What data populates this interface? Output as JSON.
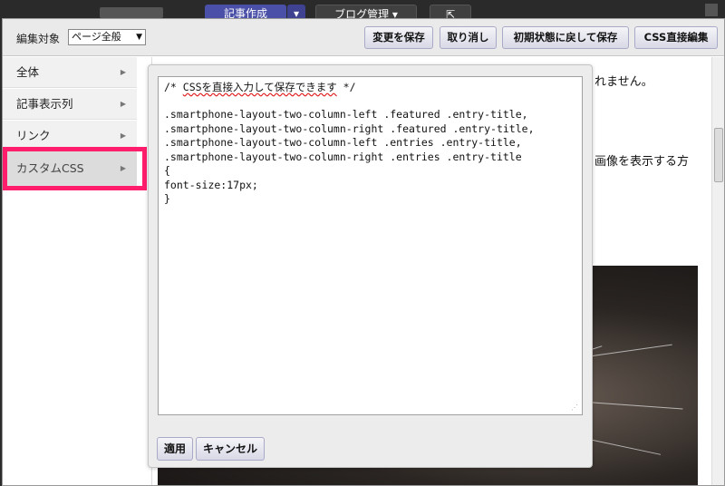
{
  "topnav": {
    "create_label": "記事作成",
    "manage_label": "ブログ管理 ▾",
    "external_label": "⇱"
  },
  "toolbar": {
    "target_label": "編集対象",
    "target_value": "ページ全般",
    "save_label": "変更を保存",
    "undo_label": "取り消し",
    "reset_label": "初期状態に戻して保存",
    "css_edit_label": "CSS直接編集"
  },
  "menu": {
    "items": [
      {
        "label": "全体"
      },
      {
        "label": "記事表示列"
      },
      {
        "label": "リンク"
      },
      {
        "label": "カスタムCSS"
      }
    ]
  },
  "preview": {
    "text1": "れません。",
    "text2": "画像を表示する方"
  },
  "editor": {
    "lines": [
      "/* CSSを直接入力して保存できます */",
      "",
      ".smartphone-layout-two-column-left .featured .entry-title,",
      ".smartphone-layout-two-column-right .featured .entry-title,",
      ".smartphone-layout-two-column-left .entries .entry-title,",
      ".smartphone-layout-two-column-right .entries .entry-title",
      "{",
      "font-size:17px;",
      "}"
    ]
  },
  "popup": {
    "apply_label": "適用",
    "cancel_label": "キャンセル"
  },
  "colors": {
    "highlight": "#ff1d6c",
    "nav_create": "#4a4fa8"
  }
}
